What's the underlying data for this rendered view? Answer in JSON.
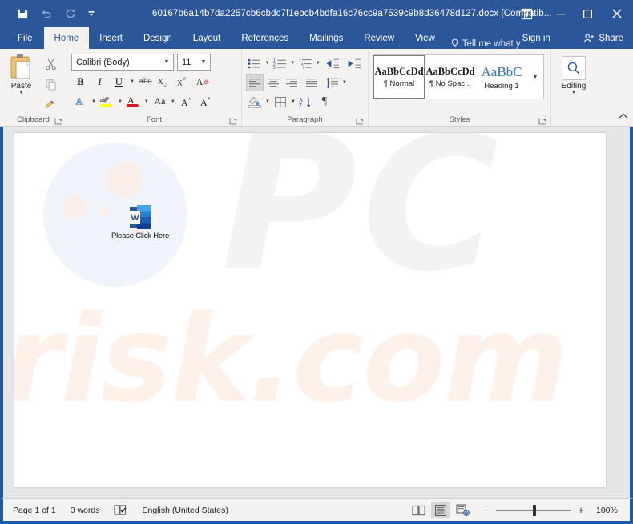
{
  "window": {
    "title": "60167b6a14b7da2257cb6cbdc7f1ebcb4bdfa16c76cc9a7539c9b8d36478d127.docx [Compatib...",
    "accent_color": "#2b579a",
    "border_color": "#1c58a8"
  },
  "quick_access": {
    "save": "Save",
    "undo": "Undo",
    "redo": "Redo",
    "customize": "Customize Quick Access Toolbar"
  },
  "window_controls": {
    "ribbon_display": "Ribbon Display Options",
    "minimize": "Minimize",
    "restore": "Restore Down",
    "close": "Close"
  },
  "tabs": [
    {
      "label": "File",
      "active": false
    },
    {
      "label": "Home",
      "active": true
    },
    {
      "label": "Insert",
      "active": false
    },
    {
      "label": "Design",
      "active": false
    },
    {
      "label": "Layout",
      "active": false
    },
    {
      "label": "References",
      "active": false
    },
    {
      "label": "Mailings",
      "active": false
    },
    {
      "label": "Review",
      "active": false
    },
    {
      "label": "View",
      "active": false
    }
  ],
  "tellme": {
    "label": "Tell me what y"
  },
  "signin": {
    "label": "Sign in"
  },
  "share": {
    "label": "Share"
  },
  "ribbon": {
    "clipboard": {
      "group_label": "Clipboard",
      "paste_label": "Paste",
      "cut_label": "Cut",
      "copy_label": "Copy",
      "format_painter_label": "Format Painter"
    },
    "font": {
      "group_label": "Font",
      "font_name": "Calibri (Body)",
      "font_size": "11",
      "bold": "B",
      "italic": "I",
      "underline": "U",
      "strikethrough": "abc",
      "subscript": "X₂",
      "superscript": "X²",
      "clear_formatting": "Clear All Formatting",
      "text_effects": "Text Effects and Typography",
      "highlight": "Text Highlight Color",
      "font_color": "Font Color",
      "change_case": "Aa",
      "grow_font": "Increase Font Size",
      "shrink_font": "Decrease Font Size"
    },
    "paragraph": {
      "group_label": "Paragraph",
      "bullets": "Bullets",
      "numbering": "Numbering",
      "multilevel": "Multilevel List",
      "decrease_indent": "Decrease Indent",
      "increase_indent": "Increase Indent",
      "align_left": "Align Left",
      "center": "Center",
      "align_right": "Align Right",
      "justify": "Justify",
      "line_spacing": "Line and Paragraph Spacing",
      "shading": "Shading",
      "borders": "Borders",
      "sort": "Sort",
      "show_marks": "Show/Hide ¶"
    },
    "styles": {
      "group_label": "Styles",
      "items": [
        {
          "preview": "AaBbCcDd",
          "name": "¶ Normal",
          "selected": true
        },
        {
          "preview": "AaBbCcDd",
          "name": "¶ No Spac...",
          "selected": false
        },
        {
          "preview": "AaBbC",
          "name": "Heading 1",
          "selected": false
        }
      ],
      "more": "More"
    },
    "editing": {
      "group_label": "Editing",
      "label": "Editing"
    },
    "collapse": "Collapse the Ribbon"
  },
  "document": {
    "object_label": "Please Click Here",
    "object_icon": "word-document-icon",
    "watermark_top": "PC",
    "watermark_bottom": "risk.com",
    "watermark_color_top": "#f2f3f4",
    "watermark_color_bottom": "#fdf1ea"
  },
  "statusbar": {
    "page": "Page 1 of 1",
    "words": "0 words",
    "proofing": "Proofing Errors",
    "language": "English (United States)",
    "views": [
      {
        "name": "read-mode",
        "selected": false
      },
      {
        "name": "print-layout",
        "selected": true
      },
      {
        "name": "web-layout",
        "selected": false
      }
    ],
    "zoom_out": "−",
    "zoom_in": "+",
    "zoom_value": "100%"
  }
}
